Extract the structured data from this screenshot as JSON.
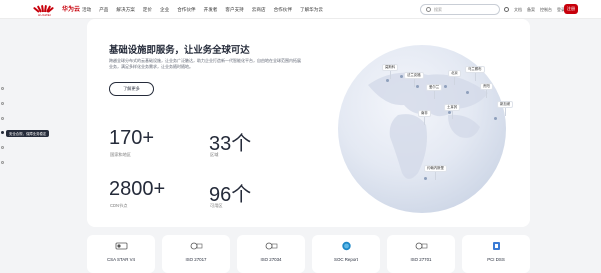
{
  "header": {
    "logo_text": "HUAWEI",
    "brand": "华为云",
    "nav": [
      "活动",
      "产品",
      "解决方案",
      "定价",
      "企业",
      "合作伙伴",
      "开发者",
      "客户支持",
      "云商店",
      "合作伙伴",
      "了解华为云"
    ],
    "search_placeholder": "搜索",
    "links": [
      "文档",
      "备案",
      "控制台",
      "登录"
    ],
    "register": "注册"
  },
  "hero": {
    "headline": "基础设施即服务，让业务全球可达",
    "description": "跨越全球分布式的云基础设施，让业务广泛触达，助力企业打造新一代智能化平台，自由地在全球范围内拓展业务，满足多样化业务需求，让业务随时随地。",
    "cta": "了解更多"
  },
  "stats": [
    {
      "value": "170+",
      "label": "国家和地区"
    },
    {
      "value": "33个",
      "label": "区域"
    },
    {
      "value": "2800+",
      "label": "CDN节点"
    },
    {
      "value": "96个",
      "label": "可用区"
    }
  ],
  "globe_pins": [
    "莫斯科",
    "爱尔兰",
    "北京",
    "乌兰察布",
    "贵阳",
    "法兰克福",
    "土耳其",
    "新加坡",
    "南非",
    "约翰内斯堡"
  ],
  "side_tip": "安全合规，保障业务稳定",
  "certs": [
    "CSA STAR V4",
    "ISO 27017",
    "ISO 27034",
    "SOC Report",
    "ISO 27701",
    "PCI DSS"
  ],
  "colors": {
    "brand": "#c7000b",
    "text": "#252b3a",
    "background": "#f3f4f6"
  }
}
